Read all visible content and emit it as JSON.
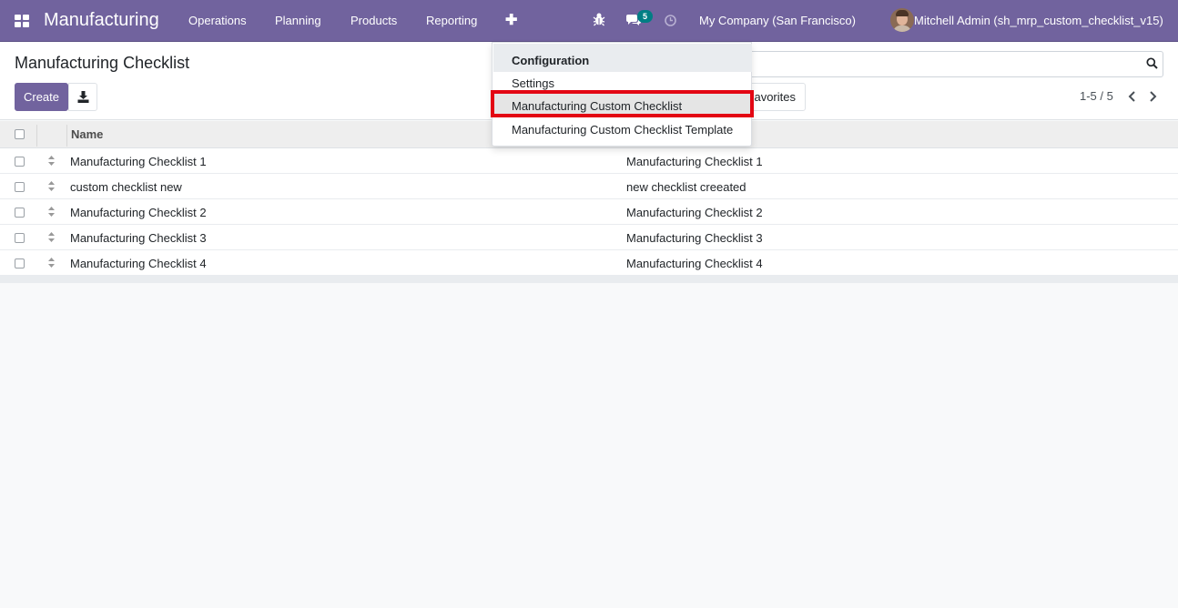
{
  "navbar": {
    "brand": "Manufacturing",
    "menu": [
      "Operations",
      "Planning",
      "Products",
      "Reporting"
    ],
    "plus_icon": "plus-icon",
    "chat_badge": "5",
    "company": "My Company (San Francisco)",
    "user": "Mitchell Admin (sh_mrp_custom_checklist_v15)",
    "color": "#71639e"
  },
  "control_panel": {
    "title": "Manufacturing Checklist",
    "create_label": "Create",
    "favorites_label": "avorites",
    "pager": "1-5 / 5"
  },
  "table": {
    "columns": [
      "Name",
      ""
    ],
    "rows": [
      [
        "Manufacturing Checklist 1",
        "Manufacturing Checklist 1"
      ],
      [
        "custom checklist new",
        "new checklist creeated"
      ],
      [
        "Manufacturing Checklist 2",
        "Manufacturing Checklist 2"
      ],
      [
        "Manufacturing Checklist 3",
        "Manufacturing Checklist 3"
      ],
      [
        "Manufacturing Checklist 4",
        "Manufacturing Checklist 4"
      ]
    ]
  },
  "dropdown": {
    "header": "Configuration",
    "items": [
      "Settings",
      "Manufacturing Custom Checklist",
      "Manufacturing Custom Checklist Template"
    ],
    "highlight_color": "#e30613"
  }
}
